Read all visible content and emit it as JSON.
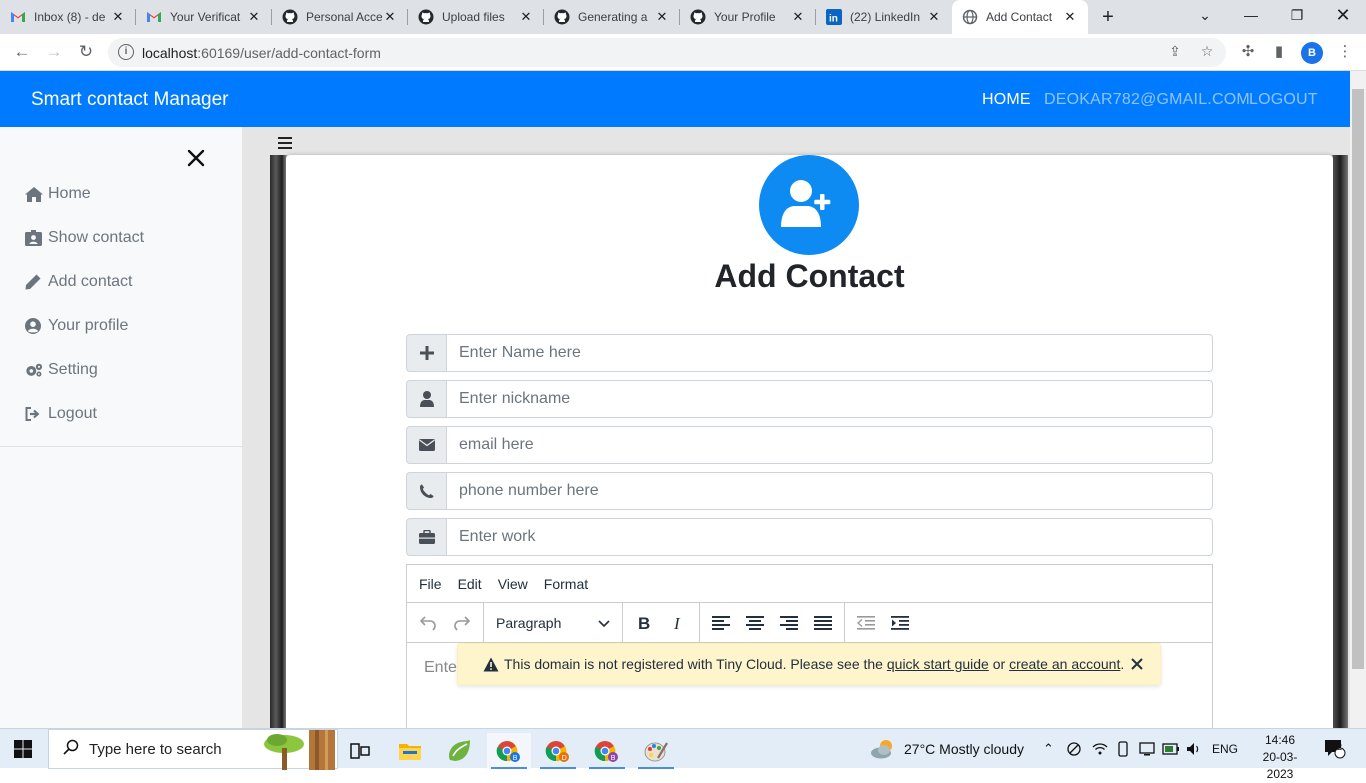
{
  "browser": {
    "tabs": [
      {
        "icon": "gmail-icon",
        "label": "Inbox (8) - de"
      },
      {
        "icon": "gmail-icon",
        "label": "Your Verificat"
      },
      {
        "icon": "github-icon",
        "label": "Personal Acce"
      },
      {
        "icon": "github-icon",
        "label": "Upload files"
      },
      {
        "icon": "github-icon",
        "label": "Generating a"
      },
      {
        "icon": "github-icon",
        "label": "Your Profile"
      },
      {
        "icon": "linkedin-icon",
        "label": "(22) LinkedIn"
      },
      {
        "icon": "globe-icon",
        "label": "Add Contact",
        "active": true
      }
    ],
    "url_host": "localhost",
    "url_rest": ":60169/user/add-contact-form",
    "profile_initial": "B"
  },
  "navbar": {
    "brand": "Smart contact Manager",
    "links": [
      "HOME",
      "DEOKAR782@GMAIL.COM",
      "LOGOUT"
    ],
    "color": "#007bff"
  },
  "sidebar": {
    "items": [
      {
        "icon": "home-icon",
        "label": "Home"
      },
      {
        "icon": "id-card-icon",
        "label": "Show contact"
      },
      {
        "icon": "pencil-icon",
        "label": "Add contact"
      },
      {
        "icon": "user-circle-icon",
        "label": "Your profile"
      },
      {
        "icon": "cogs-icon",
        "label": "Setting"
      },
      {
        "icon": "sign-out-icon",
        "label": "Logout"
      }
    ]
  },
  "form": {
    "title": "Add Contact",
    "fields": [
      {
        "icon": "plus-icon",
        "placeholder": "Enter Name here",
        "value": ""
      },
      {
        "icon": "user-icon",
        "placeholder": "Enter nickname",
        "value": ""
      },
      {
        "icon": "envelope-icon",
        "placeholder": "email here",
        "value": ""
      },
      {
        "icon": "phone-icon",
        "placeholder": "phone number here",
        "value": ""
      },
      {
        "icon": "briefcase-icon",
        "placeholder": "Enter work",
        "value": ""
      }
    ],
    "editor": {
      "menus": [
        "File",
        "Edit",
        "View",
        "Format"
      ],
      "block_format": "Paragraph",
      "placeholder_visible": "Enter"
    },
    "notice": {
      "text_before": "This domain is not registered with Tiny Cloud. Please see the ",
      "link1": "quick start guide",
      "text_mid": " or ",
      "link2": "create an account",
      "text_after": "."
    }
  },
  "taskbar": {
    "search_placeholder": "Type here to search",
    "weather": "27°C  Mostly cloudy",
    "lang": "ENG",
    "time": "14:46",
    "date": "20-03-2023",
    "notifications": "2"
  }
}
